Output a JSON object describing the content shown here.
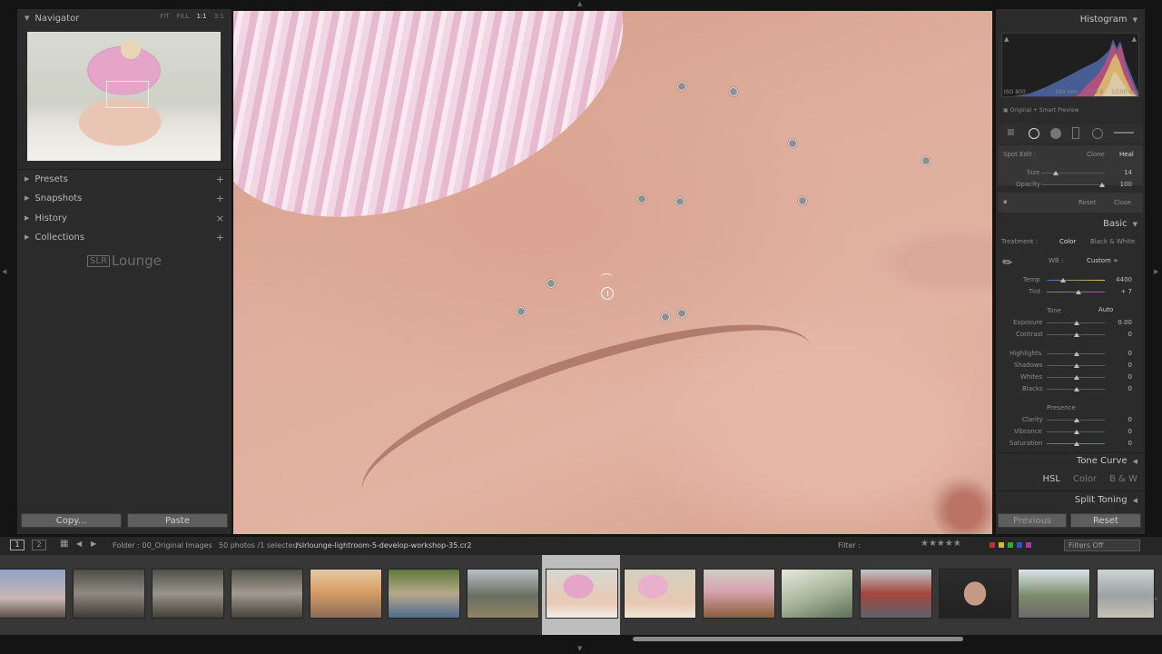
{
  "left_panel": {
    "navigator": {
      "title": "Navigator",
      "zoom": [
        "FIT",
        "FILL",
        "1:1",
        "3:1"
      ],
      "zoom_active": "1:1"
    },
    "sections": [
      {
        "label": "Presets",
        "action": "+"
      },
      {
        "label": "Snapshots",
        "action": "+"
      },
      {
        "label": "History",
        "action": "×"
      },
      {
        "label": "Collections",
        "action": "+"
      }
    ],
    "logo": {
      "bracket": "SLR",
      "text": "Lounge"
    },
    "copy_label": "Copy...",
    "paste_label": "Paste"
  },
  "right_panel": {
    "histogram": {
      "title": "Histogram",
      "iso": "ISO 800",
      "focal": "100 mm",
      "aperture": "f / 2.8",
      "shutter": "1/100 sec",
      "preview": "Original + Smart Preview"
    },
    "spot_edit": {
      "label": "Spot Edit :",
      "modes": [
        "Clone",
        "Heal"
      ],
      "active_mode": "Heal",
      "size_label": "Size",
      "size_value": "14",
      "opacity_label": "Opacity",
      "opacity_value": "100",
      "reset": "Reset",
      "close": "Close"
    },
    "basic": {
      "title": "Basic",
      "treatment_label": "Treatment :",
      "treatment_color": "Color",
      "treatment_bw": "Black & White",
      "wb_label": "WB :",
      "wb_value": "Custom ÷",
      "temp_label": "Temp",
      "temp_value": "4400",
      "tint_label": "Tint",
      "tint_value": "+ 7",
      "tone_label": "Tone",
      "auto_label": "Auto",
      "sliders": [
        {
          "label": "Exposure",
          "value": "0.00"
        },
        {
          "label": "Contrast",
          "value": "0"
        },
        {
          "label": "Highlights",
          "value": "0"
        },
        {
          "label": "Shadows",
          "value": "0"
        },
        {
          "label": "Whites",
          "value": "0"
        },
        {
          "label": "Blacks",
          "value": "0"
        }
      ],
      "presence_label": "Presence",
      "presence": [
        {
          "label": "Clarity",
          "value": "0"
        },
        {
          "label": "Vibrance",
          "value": "0"
        },
        {
          "label": "Saturation",
          "value": "0"
        }
      ]
    },
    "tone_curve": "Tone Curve",
    "hsl": {
      "hsl": "HSL",
      "color": "Color",
      "bw": "B & W"
    },
    "split_toning": "Split Toning",
    "previous": "Previous",
    "reset": "Reset"
  },
  "filmstrip": {
    "page1": "1",
    "page2": "2",
    "folder": "Folder : 00_Original Images",
    "count": "50 photos /1 selected",
    "filename": "/slrlounge-lightroom-5-develop-workshop-35.cr2",
    "filter_label": "Filter :",
    "filters_off": "Filters Off",
    "stars": "★★★★★",
    "selected_index": 7
  },
  "colors": {
    "panel": "#2b2b2b",
    "subpanel": "#363636",
    "background": "#141414",
    "filmstrip": "#373737"
  }
}
